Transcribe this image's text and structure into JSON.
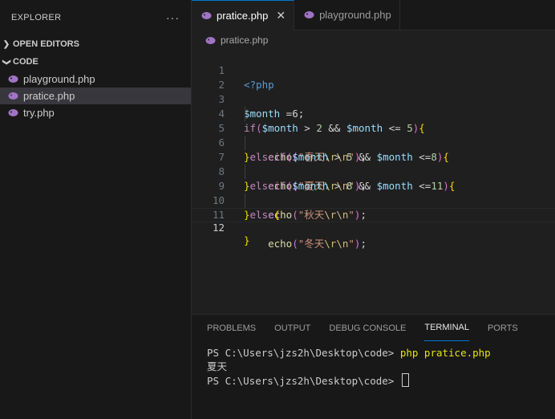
{
  "sidebar": {
    "title": "EXPLORER",
    "more": "···",
    "sections": {
      "open_editors": "OPEN EDITORS",
      "code": "CODE"
    },
    "files": [
      "playground.php",
      "pratice.php",
      "try.php"
    ]
  },
  "tabs": [
    {
      "label": "pratice.php",
      "close": "✕"
    },
    {
      "label": "playground.php"
    }
  ],
  "breadcrumb": "pratice.php",
  "editor": {
    "line_numbers": [
      "1",
      "2",
      "3",
      "4",
      "5",
      "6",
      "7",
      "8",
      "9",
      "10",
      "11",
      "12"
    ],
    "code": {
      "l1": "<?php",
      "l3": {
        "var": "$month",
        "rest": " =6;"
      },
      "l4": {
        "kw": "if",
        "open": "(",
        "var1": "$month",
        "op1": " > ",
        "n1": "2",
        "op2": " && ",
        "var2": "$month",
        "op3": " <= ",
        "n2": "5",
        "close": ")",
        "brace": "{"
      },
      "l5": {
        "fn": "echo",
        "open": "(",
        "q1": "\"春天",
        "esc": "\\r\\n",
        "q2": "\"",
        "close": ")",
        "semi": ";"
      },
      "l6": {
        "brace": "}",
        "kw": "elseif",
        "open": "(",
        "var1": "$month",
        "op1": " > ",
        "n1": "5",
        "op2": " && ",
        "var2": "$month",
        "op3": " <=",
        "n2": "8",
        "close": ")",
        "brace2": "{"
      },
      "l7": {
        "fn": "echo",
        "open": "(",
        "q1": "\"夏天",
        "esc": "\\r\\n",
        "q2": "\"",
        "close": ")",
        "semi": ";"
      },
      "l8": {
        "brace": "}",
        "kw": "elseif",
        "open": "(",
        "var1": "$month",
        "op1": " > ",
        "n1": "8",
        "op2": " && ",
        "var2": "$month",
        "op3": " <=",
        "n2": "11",
        "close": ")",
        "brace2": "{"
      },
      "l9": {
        "fn": "echo",
        "open": "(",
        "q1": "\"秋天",
        "esc": "\\r\\n",
        "q2": "\"",
        "close": ")",
        "semi": ";"
      },
      "l10": {
        "brace": "}",
        "kw": "else",
        "brace2": "{"
      },
      "l11": {
        "fn": "echo",
        "open": "(",
        "q1": "\"冬天",
        "esc": "\\r\\n",
        "q2": "\"",
        "close": ")",
        "semi": ";"
      },
      "l12": "}"
    }
  },
  "panel": {
    "tabs": [
      "PROBLEMS",
      "OUTPUT",
      "DEBUG CONSOLE",
      "TERMINAL",
      "PORTS"
    ],
    "terminal": {
      "prompt1": "PS C:\\Users\\jzs2h\\Desktop\\code> ",
      "command": "php pratice.php",
      "output": "夏天",
      "prompt2": "PS C:\\Users\\jzs2h\\Desktop\\code> "
    }
  }
}
